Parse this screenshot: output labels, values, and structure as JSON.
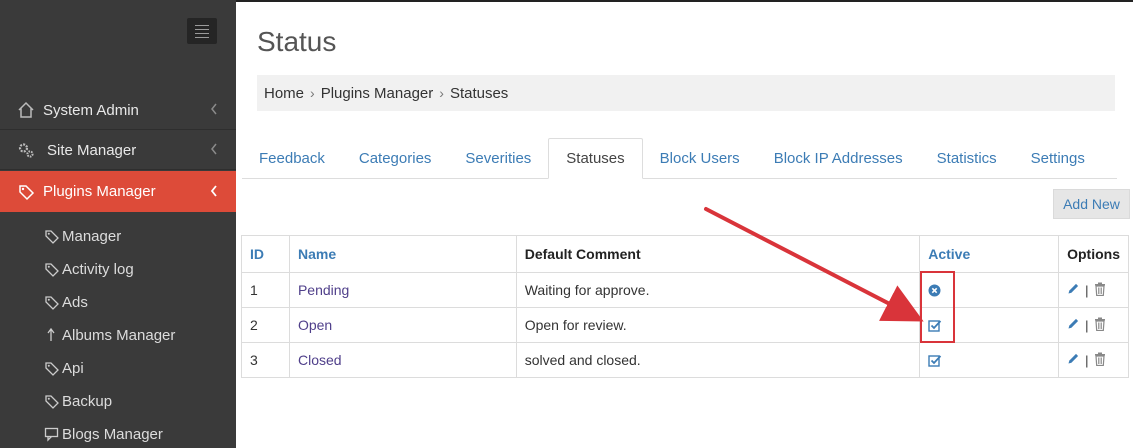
{
  "sidebar": {
    "menu": [
      {
        "label": "System Admin",
        "icon": "home-icon"
      },
      {
        "label": "Site Manager",
        "icon": "gears-icon"
      },
      {
        "label": "Plugins Manager",
        "icon": "plug-tag-icon"
      }
    ],
    "subitems": [
      {
        "label": "Manager",
        "icon": "tag-icon"
      },
      {
        "label": "Activity log",
        "icon": "tag-icon"
      },
      {
        "label": "Ads",
        "icon": "tag-icon"
      },
      {
        "label": "Albums Manager",
        "icon": "upload-arrow-icon"
      },
      {
        "label": "Api",
        "icon": "tag-icon"
      },
      {
        "label": "Backup",
        "icon": "tag-icon"
      },
      {
        "label": "Blogs Manager",
        "icon": "comment-icon"
      }
    ]
  },
  "page": {
    "title": "Status"
  },
  "breadcrumb": [
    "Home",
    "Plugins Manager",
    "Statuses"
  ],
  "tabs": [
    "Feedback",
    "Categories",
    "Severities",
    "Statuses",
    "Block Users",
    "Block IP Addresses",
    "Statistics",
    "Settings"
  ],
  "active_tab": "Statuses",
  "add_button": "Add New",
  "table": {
    "headers": [
      "ID",
      "Name",
      "Default Comment",
      "Active",
      "Options"
    ],
    "rows": [
      {
        "id": "1",
        "name": "Pending",
        "comment": "Waiting for approve.",
        "active": false
      },
      {
        "id": "2",
        "name": "Open",
        "comment": "Open for review.",
        "active": true
      },
      {
        "id": "3",
        "name": "Closed",
        "comment": "solved and closed.",
        "active": true
      }
    ],
    "option_separator": "|"
  },
  "colors": {
    "accent": "#dd4b39",
    "link": "#3c7cb5",
    "sidebar_bg": "#3a3a3a",
    "annotation": "#d9343a"
  }
}
